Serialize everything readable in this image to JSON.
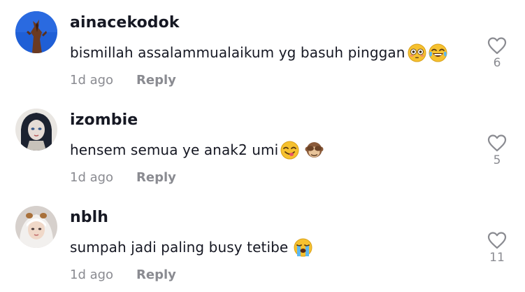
{
  "comments": [
    {
      "username": "ainacekodok",
      "text": "bismillah assalammualaikum yg basuh pinggan",
      "emojis": [
        "flushed-face-emoji",
        "tears-of-joy-emoji"
      ],
      "time": "1d ago",
      "reply_label": "Reply",
      "likes": "6",
      "avatar": "avatar-blue-sky"
    },
    {
      "username": "izombie",
      "text": "hensem semua ye anak2 umi",
      "emojis": [
        "savoring-food-face-emoji",
        "see-no-evil-monkey-emoji"
      ],
      "time": "1d ago",
      "reply_label": "Reply",
      "likes": "5",
      "avatar": "avatar-anime-portrait"
    },
    {
      "username": "nblh",
      "text": "sumpah jadi paling busy tetibe",
      "emojis": [
        "loudly-crying-face-emoji"
      ],
      "time": "1d ago",
      "reply_label": "Reply",
      "likes": "11",
      "avatar": "avatar-hijab-portrait"
    }
  ],
  "colors": {
    "text": "#161823",
    "muted": "#8a8b91",
    "background": "#ffffff",
    "emoji_yellow": "#f6c12f"
  },
  "icons": {
    "like": "heart-outline-icon"
  }
}
